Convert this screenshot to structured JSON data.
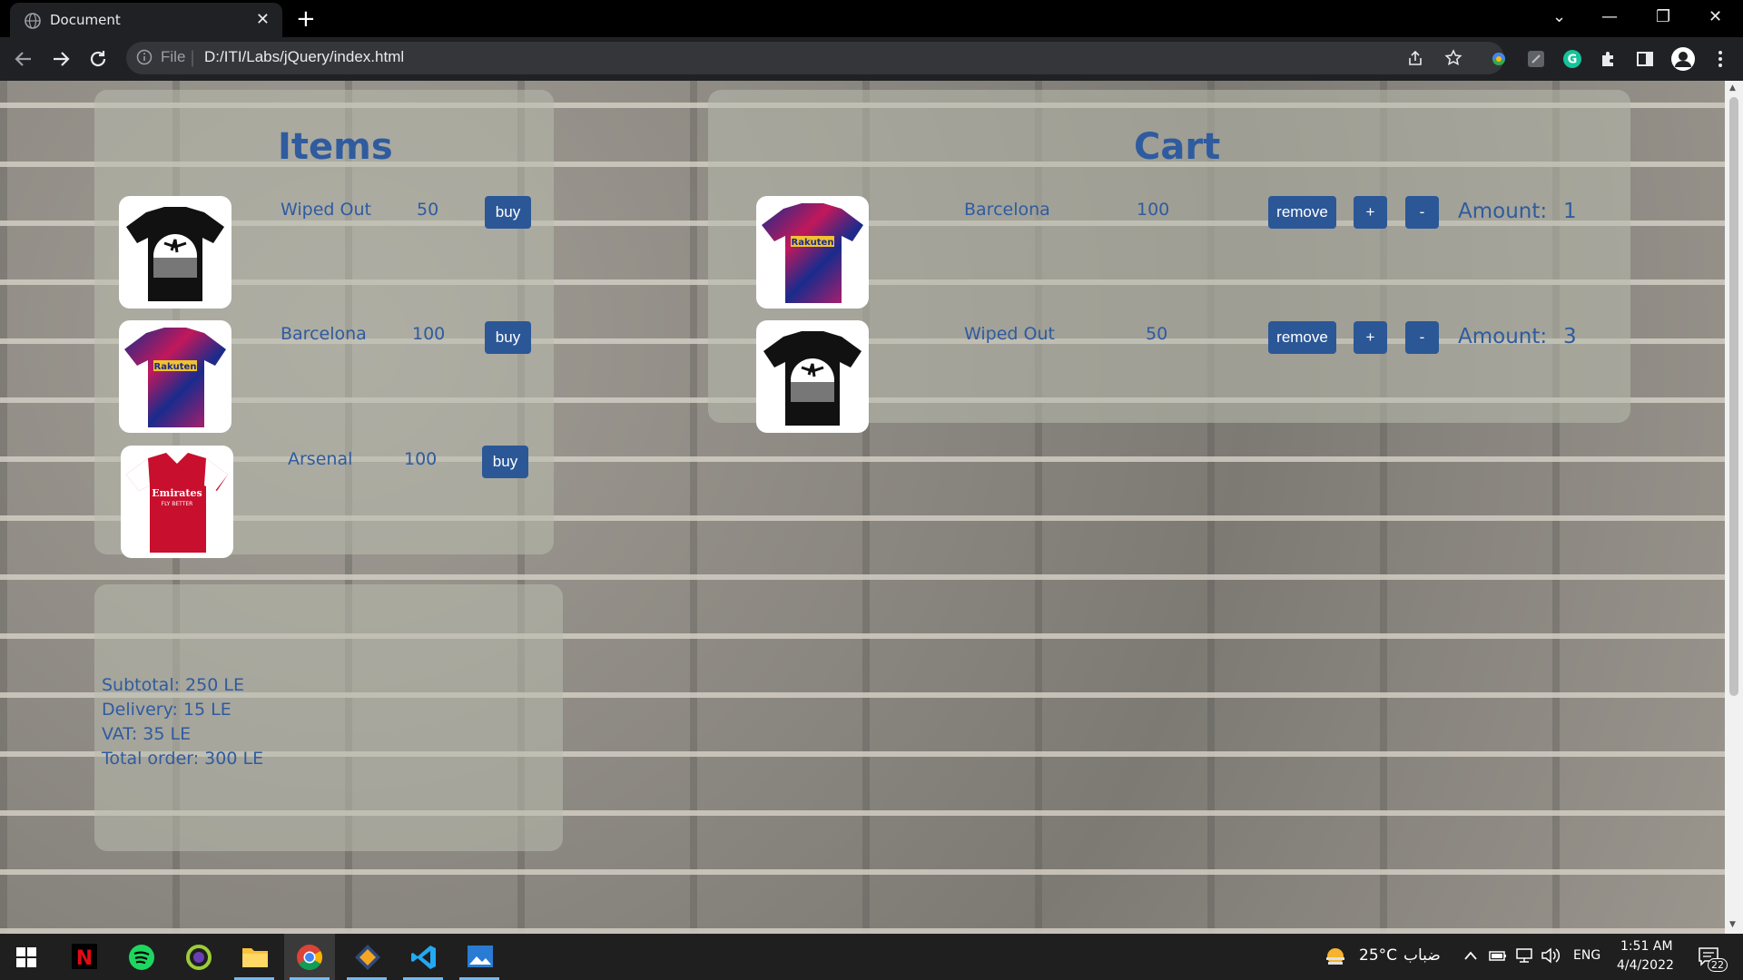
{
  "browser": {
    "tab_title": "Document",
    "tab_close": "✕",
    "new_tab": "+",
    "omnibox_scheme": "File",
    "omnibox_sep": "|",
    "url": "D:/ITI/Labs/jQuery/index.html",
    "window_controls": [
      "⌄",
      "—",
      "❐",
      "✕"
    ]
  },
  "items_panel": {
    "title": "Items",
    "buy_label": "buy",
    "items": [
      {
        "name": "Wiped Out",
        "price": "50",
        "image": "black-tshirt"
      },
      {
        "name": "Barcelona",
        "price": "100",
        "image": "barcelona-shirt"
      },
      {
        "name": "Arsenal",
        "price": "100",
        "image": "arsenal-shirt"
      }
    ]
  },
  "cart_panel": {
    "title": "Cart",
    "remove_label": "remove",
    "plus_label": "+",
    "minus_label": "-",
    "amount_label": "Amount:",
    "rows": [
      {
        "name": "Barcelona",
        "price": "100",
        "amount": "1",
        "image": "barcelona-shirt"
      },
      {
        "name": "Wiped Out",
        "price": "50",
        "amount": "3",
        "image": "black-tshirt"
      }
    ]
  },
  "summary": {
    "subtotal": "Subtotal: 250 LE",
    "delivery": "Delivery: 15 LE",
    "vat": "VAT: 35 LE",
    "total": "Total order: 300 LE"
  },
  "taskbar": {
    "weather": "25°C",
    "weather_desc": "ضباب",
    "language": "ENG",
    "time": "1:51 AM",
    "date": "4/4/2022",
    "notifications": "22"
  },
  "colors": {
    "accent_text": "#2f5b9f",
    "button": "#2b5797"
  }
}
